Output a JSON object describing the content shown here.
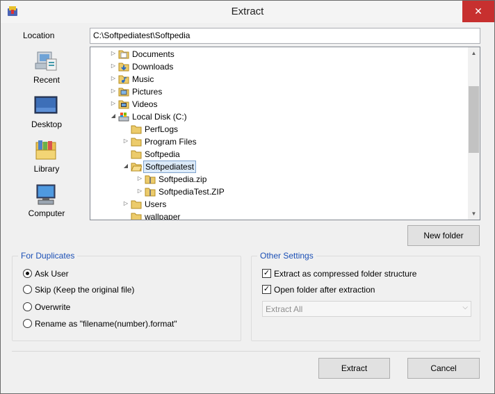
{
  "window": {
    "title": "Extract",
    "close_symbol": "✕"
  },
  "location": {
    "label": "Location",
    "value": "C:\\Softpediatest\\Softpedia"
  },
  "places": [
    {
      "label": "Recent",
      "icon": "recent-icon"
    },
    {
      "label": "Desktop",
      "icon": "desktop-icon"
    },
    {
      "label": "Library",
      "icon": "library-icon"
    },
    {
      "label": "Computer",
      "icon": "computer-icon"
    }
  ],
  "tree": [
    {
      "label": "Documents",
      "expander": "▷",
      "icon": "documents-folder-icon",
      "level": 1
    },
    {
      "label": "Downloads",
      "expander": "▷",
      "icon": "downloads-folder-icon",
      "level": 1
    },
    {
      "label": "Music",
      "expander": "▷",
      "icon": "music-folder-icon",
      "level": 1
    },
    {
      "label": "Pictures",
      "expander": "▷",
      "icon": "pictures-folder-icon",
      "level": 1
    },
    {
      "label": "Videos",
      "expander": "▷",
      "icon": "videos-folder-icon",
      "level": 1
    },
    {
      "label": "Local Disk (C:)",
      "expander": "◢",
      "icon": "drive-icon",
      "level": 1
    },
    {
      "label": "PerfLogs",
      "expander": "",
      "icon": "folder-icon",
      "level": 2
    },
    {
      "label": "Program Files",
      "expander": "▷",
      "icon": "folder-icon",
      "level": 2
    },
    {
      "label": "Softpedia",
      "expander": "",
      "icon": "folder-icon",
      "level": 2
    },
    {
      "label": "Softpediatest",
      "expander": "◢",
      "icon": "folder-open-icon",
      "level": 2,
      "selected": true
    },
    {
      "label": "Softpedia.zip",
      "expander": "▷",
      "icon": "zip-folder-icon",
      "level": 3
    },
    {
      "label": "SoftpediaTest.ZIP",
      "expander": "▷",
      "icon": "zip-folder-icon",
      "level": 3
    },
    {
      "label": "Users",
      "expander": "▷",
      "icon": "folder-icon",
      "level": 2
    },
    {
      "label": "wallpaper",
      "expander": "",
      "icon": "folder-icon",
      "level": 2
    }
  ],
  "buttons": {
    "new_folder": "New folder",
    "extract": "Extract",
    "cancel": "Cancel"
  },
  "duplicates": {
    "title": "For Duplicates",
    "options": [
      {
        "label": "Ask User",
        "checked": true
      },
      {
        "label": "Skip (Keep the original file)",
        "checked": false
      },
      {
        "label": "Overwrite",
        "checked": false
      },
      {
        "label": "Rename as \"filename(number).format\"",
        "checked": false
      }
    ]
  },
  "other": {
    "title": "Other Settings",
    "checks": [
      {
        "label": "Extract as compressed folder structure",
        "checked": true,
        "mark": "✓"
      },
      {
        "label": "Open folder after extraction",
        "checked": true,
        "mark": "✓"
      }
    ],
    "select_value": "Extract All"
  },
  "colors": {
    "accent_title": "#1b4fb5",
    "close_button": "#c7302f",
    "selection": "#dceaf8"
  }
}
